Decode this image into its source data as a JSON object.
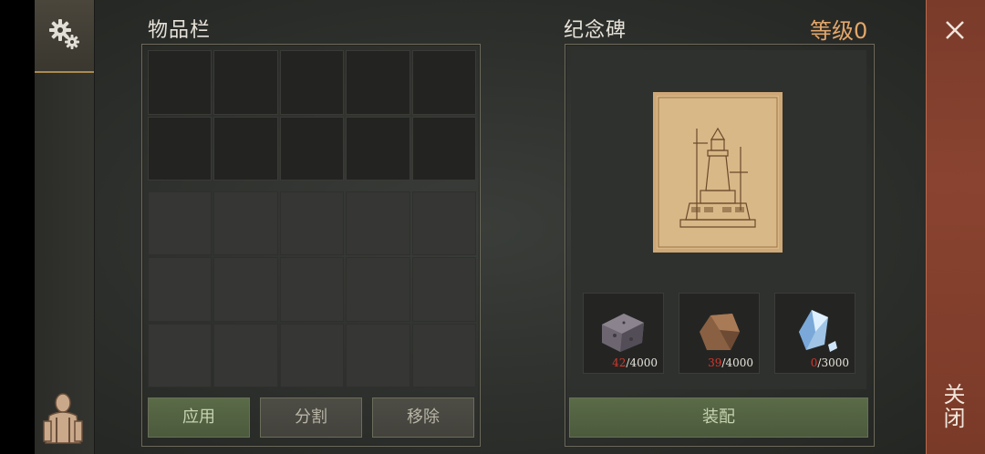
{
  "inventory": {
    "title": "物品栏",
    "buttons": {
      "apply": "应用",
      "split": "分割",
      "remove": "移除"
    }
  },
  "monument": {
    "title": "纪念碑",
    "level": "等级0",
    "resources": [
      {
        "icon": "stone-block-icon",
        "have": "42",
        "need": "/4000"
      },
      {
        "icon": "rock-ore-icon",
        "have": "39",
        "need": "/4000"
      },
      {
        "icon": "crystal-icon",
        "have": "0",
        "need": "/3000"
      }
    ],
    "equip_label": "装配"
  },
  "close": {
    "label": "关闭"
  },
  "colors": {
    "level": "#e3a76a",
    "missing": "#d4372d",
    "close_bar": "#8a4330"
  }
}
